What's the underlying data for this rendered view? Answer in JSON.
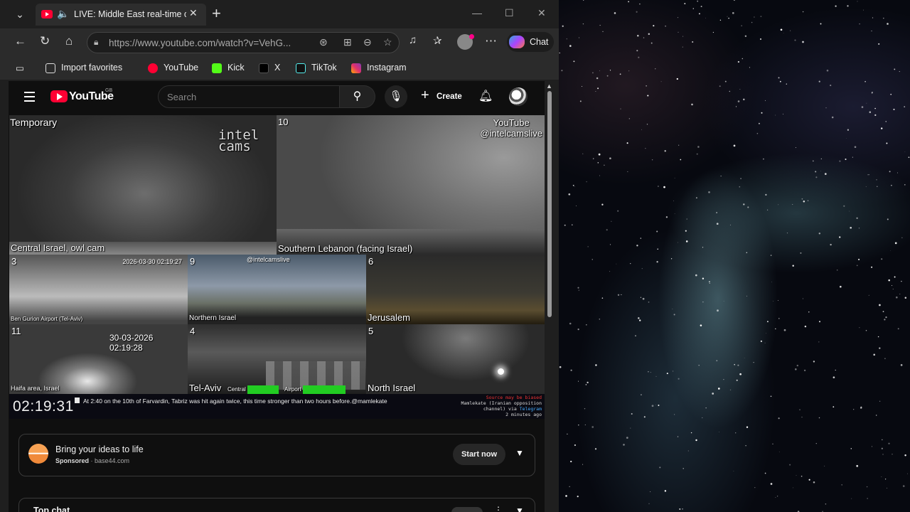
{
  "browser": {
    "tab": {
      "title": "LIVE: Middle East real-time camera"
    },
    "address_bar": {
      "url_host": "https://www.youtube.com",
      "url_path": "/watch?v=VehG..."
    },
    "chat_label": "Chat",
    "favorites": [
      {
        "label": "Import favorites",
        "icon": "import-icon"
      },
      {
        "label": "YouTube",
        "icon": "youtube-icon"
      },
      {
        "label": "Kick",
        "icon": "kick-icon"
      },
      {
        "label": "X",
        "icon": "x-icon"
      },
      {
        "label": "TikTok",
        "icon": "tiktok-icon"
      },
      {
        "label": "Instagram",
        "icon": "instagram-icon"
      }
    ]
  },
  "youtube": {
    "logo_text": "YouTube",
    "country": "GB",
    "search_placeholder": "Search",
    "create_label": "Create"
  },
  "video": {
    "cams": {
      "main_left": {
        "top_label": "Temporary",
        "bottom_label": "Central Israel, owl cam",
        "watermark_line1": "intel",
        "watermark_line2": "cams"
      },
      "main_right": {
        "number": "10",
        "bottom_label": "Southern Lebanon (facing Israel)",
        "channel_line1": "YouTube",
        "channel_line2": "@intelcamslive"
      },
      "cam3": {
        "number": "3",
        "label": "Ben Gurion Airport (Tel-Aviv)",
        "timestamp": "2026-03-30 02:19:27"
      },
      "cam9": {
        "number": "9",
        "label": "Northern Israel",
        "handle": "@intelcamslive"
      },
      "cam6": {
        "number": "6",
        "label": "Jerusalem"
      },
      "cam11": {
        "number": "11",
        "label": "Haifa area, Israel",
        "timestamp": "30-03-2026 02:19:28"
      },
      "cam4": {
        "number": "4",
        "label": "Tel-Aviv",
        "sub1": "Central",
        "sub2": "Airport"
      },
      "cam5": {
        "number": "5",
        "label": "North Israel"
      }
    },
    "clock": "02:19:31",
    "ticker": "At 2:40 on the 10th of Farvardin, Tabriz was hit again twice, this time stronger than two hours before.@mamlekate",
    "source": {
      "line1": "Source may be biased",
      "line2": "Mamlekate (Iranian opposition",
      "line3a": "channel) via ",
      "line3b": "Telegram",
      "line4": "2 minutes ago"
    }
  },
  "ad": {
    "title": "Bring your ideas to life",
    "sponsored": "Sponsored",
    "domain": "· base44.com",
    "cta": "Start now"
  },
  "chat_panel": {
    "title": "Top chat"
  }
}
